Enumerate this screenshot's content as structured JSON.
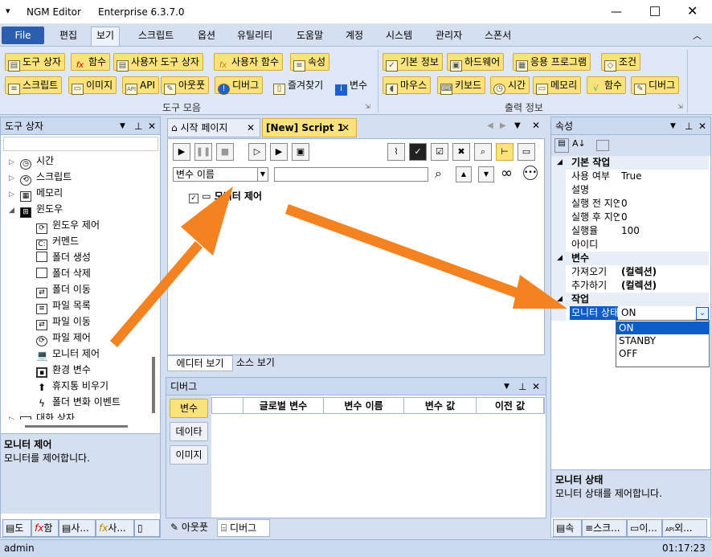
{
  "window": {
    "title": "NGM Editor",
    "edition": "Enterprise 6.3.7.0"
  },
  "menu": {
    "file": "File",
    "items": [
      "편집",
      "보기",
      "스크립트",
      "옵션",
      "유틸리티",
      "도움말",
      "계정",
      "시스템",
      "관리자",
      "스폰서"
    ],
    "active": "보기"
  },
  "ribbon": {
    "group1": {
      "label": "도구 모음",
      "row1": [
        "도구 상자",
        "함수",
        "사용자 도구 상자",
        "사용자 함수",
        "속성"
      ],
      "row2": [
        "스크립트",
        "이미지",
        "API",
        "아웃풋",
        "디버그",
        "즐겨찾기",
        "변수"
      ]
    },
    "group2": {
      "label": "출력 정보",
      "row1": [
        "기본 정보",
        "하드웨어",
        "응용 프로그램",
        "조건"
      ],
      "row2": [
        "마우스",
        "키보드",
        "시간",
        "메모리",
        "함수",
        "디버그"
      ]
    }
  },
  "toolbox": {
    "title": "도구 상자",
    "items": [
      "시간",
      "스크립트",
      "메모리",
      "윈도우"
    ],
    "children": [
      "윈도우 제어",
      "커멘드",
      "폴더 생성",
      "폴더 삭제",
      "폴더 이동",
      "파일 목록",
      "파일 이동",
      "파일 제어",
      "모니터 제어",
      "환경 변수",
      "휴지통 비우기",
      "폴더 변화 이벤트"
    ],
    "last": "대화 상자",
    "desc_title": "모니터 제어",
    "desc": "모니터를 제어합니다.",
    "bottom_tabs": [
      "도",
      "함",
      "사...",
      "사...",
      ""
    ]
  },
  "editor": {
    "tabs": [
      "시작 페이지",
      "[New] Script 1"
    ],
    "var_select": "변수 이름",
    "node": "모니터 제어",
    "view_tabs": [
      "에디터 보기",
      "소스 보기"
    ]
  },
  "debug": {
    "title": "디버그",
    "side": [
      "변수",
      "데이타",
      "이미지"
    ],
    "cols": [
      "글로벌 변수",
      "변수 이름",
      "변수 값",
      "이전 값"
    ],
    "bottom_tabs": [
      "아웃풋",
      "디버그"
    ]
  },
  "props": {
    "title": "속성",
    "cat1": "기본 작업",
    "rows1": [
      [
        "사용 여부",
        "True"
      ],
      [
        "설명",
        ""
      ],
      [
        "실행 전 지연",
        "0"
      ],
      [
        "실행 후 지연",
        "0"
      ],
      [
        "실행율",
        "100"
      ],
      [
        "아이디",
        ""
      ]
    ],
    "cat2": "변수",
    "rows2": [
      [
        "가져오기",
        "(컬렉션)"
      ],
      [
        "추가하기",
        "(컬렉션)"
      ]
    ],
    "cat3": "작업",
    "rows3": [
      [
        "모니터 상태",
        "ON"
      ]
    ],
    "options": [
      "ON",
      "STANBY",
      "OFF"
    ],
    "desc_title": "모니터 상태",
    "desc": "모니터 상태를 제어합니다.",
    "bottom_tabs": [
      "속",
      "스크...",
      "이...",
      "외..."
    ]
  },
  "status": {
    "user": "admin",
    "time": "01:17:23"
  }
}
